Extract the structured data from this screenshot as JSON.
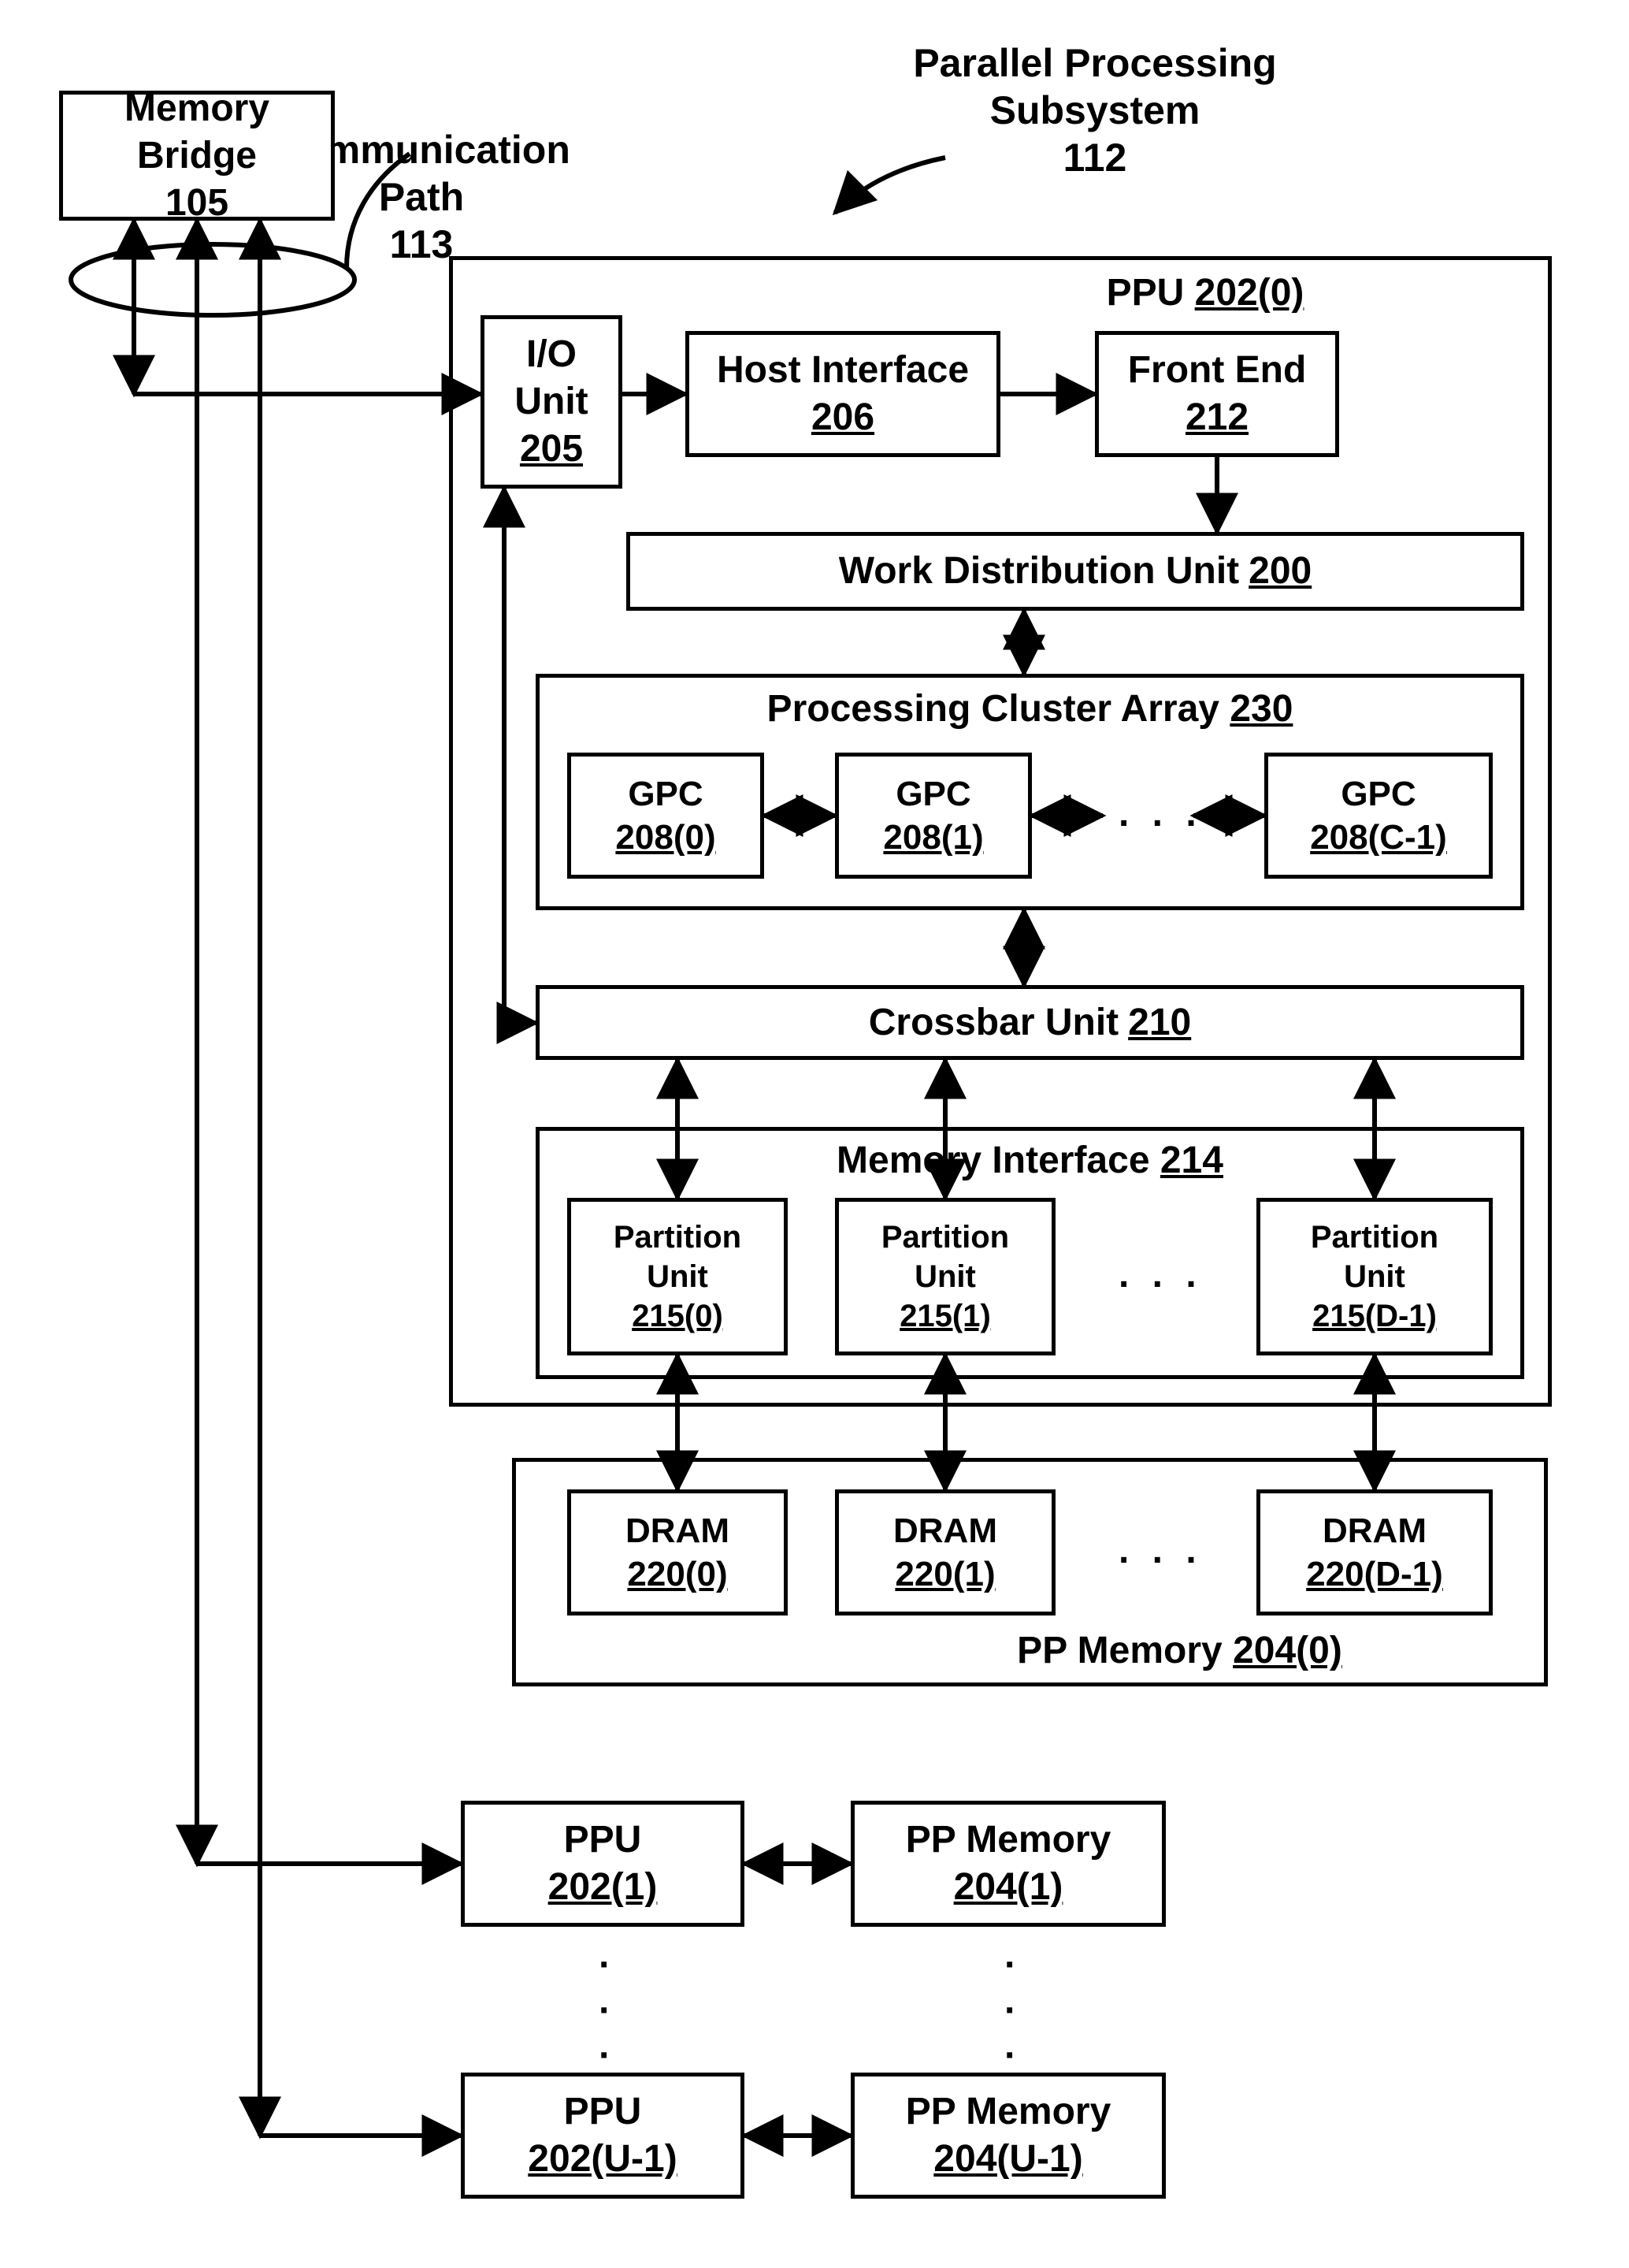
{
  "memory_bridge": {
    "name": "Memory Bridge",
    "ref": "105"
  },
  "comm_path": {
    "name": "Communication\nPath",
    "ref": "113"
  },
  "subsystem": {
    "name": "Parallel Processing\nSubsystem",
    "ref": "112"
  },
  "ppu0": {
    "name": "PPU",
    "ref": "202(0)"
  },
  "io_unit": {
    "name": "I/O\nUnit",
    "ref": "205"
  },
  "host_if": {
    "name": "Host Interface",
    "ref": "206"
  },
  "front_end": {
    "name": "Front End",
    "ref": "212"
  },
  "wdu": {
    "name": "Work Distribution Unit",
    "ref": "200"
  },
  "pca": {
    "name": "Processing Cluster Array",
    "ref": "230"
  },
  "gpc0": {
    "name": "GPC",
    "ref": "208(0)"
  },
  "gpc1": {
    "name": "GPC",
    "ref": "208(1)"
  },
  "gpcC": {
    "name": "GPC",
    "ref": "208(C-1)"
  },
  "xbar": {
    "name": "Crossbar Unit",
    "ref": "210"
  },
  "memif": {
    "name": "Memory Interface",
    "ref": "214"
  },
  "pu0": {
    "name": "Partition\nUnit",
    "ref": "215(0)"
  },
  "pu1": {
    "name": "Partition\nUnit",
    "ref": "215(1)"
  },
  "puD": {
    "name": "Partition\nUnit",
    "ref": "215(D-1)"
  },
  "ppmem0": {
    "name": "PP Memory",
    "ref": "204(0)"
  },
  "dram0": {
    "name": "DRAM",
    "ref": "220(0)"
  },
  "dram1": {
    "name": "DRAM",
    "ref": "220(1)"
  },
  "dramD": {
    "name": "DRAM",
    "ref": "220(D-1)"
  },
  "ppu1": {
    "name": "PPU",
    "ref": "202(1)"
  },
  "ppmem1": {
    "name": "PP Memory",
    "ref": "204(1)"
  },
  "ppuU": {
    "name": "PPU",
    "ref": "202(U-1)"
  },
  "ppmemU": {
    "name": "PP Memory",
    "ref": "204(U-1)"
  },
  "ellipsis": ". . ."
}
